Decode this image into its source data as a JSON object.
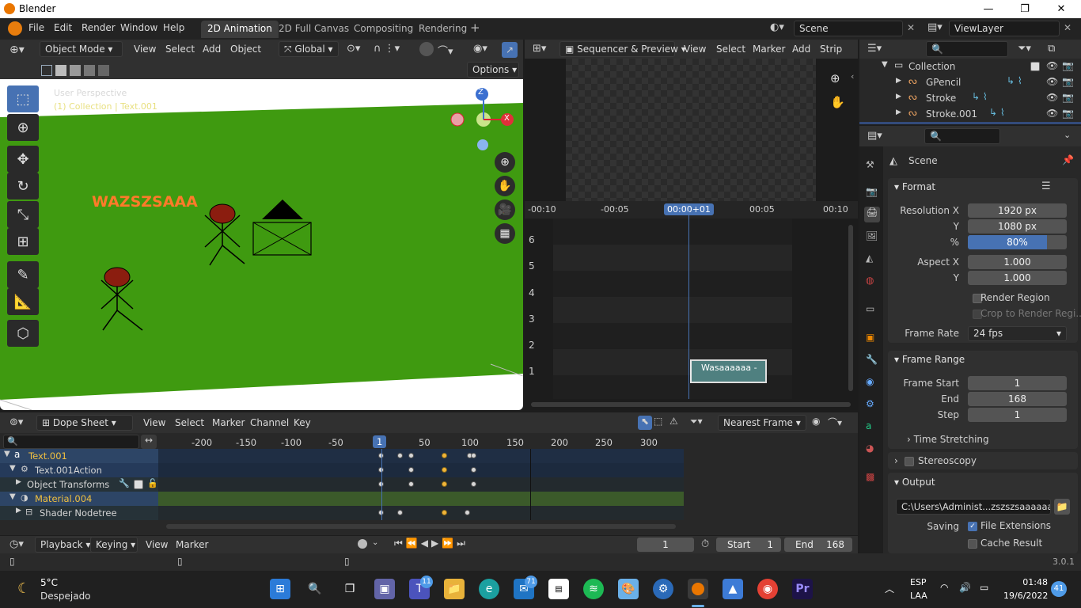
{
  "window": {
    "title": "Blender",
    "min": "—",
    "max": "❐",
    "close": "✕"
  },
  "menu": [
    "File",
    "Edit",
    "Render",
    "Window",
    "Help"
  ],
  "workspaces": [
    {
      "label": "2D Animation",
      "active": true
    },
    {
      "label": "2D Full Canvas",
      "active": false
    },
    {
      "label": "Compositing",
      "active": false
    },
    {
      "label": "Rendering",
      "active": false
    }
  ],
  "scene": {
    "name": "Scene",
    "viewlayer": "ViewLayer"
  },
  "viewport": {
    "mode": "Object Mode",
    "menus": [
      "View",
      "Select",
      "Add",
      "Object"
    ],
    "transform": "Global",
    "options": "Options",
    "overlay_line1": "User Perspective",
    "overlay_line2": "(1) Collection | Text.001",
    "text_object": "WAZSZSAAA",
    "gizmo": {
      "z": "Z",
      "x": "X"
    }
  },
  "sequencer": {
    "mode": "Sequencer & Preview",
    "menus": [
      "View",
      "Select",
      "Marker",
      "Add",
      "Strip"
    ],
    "ruler": [
      "-00:10",
      "-00:05",
      "00:00+01",
      "00:05",
      "00:10"
    ],
    "channels": [
      "6",
      "5",
      "4",
      "3",
      "2",
      "1"
    ],
    "strip": "Wasaaaaaa -"
  },
  "outliner": {
    "items": [
      {
        "name": "Collection",
        "level": 0
      },
      {
        "name": "GPencil",
        "level": 1
      },
      {
        "name": "Stroke",
        "level": 1
      },
      {
        "name": "Stroke.001",
        "level": 1
      }
    ]
  },
  "properties": {
    "context": "Scene",
    "format": {
      "title": "Format",
      "res_x_label": "Resolution X",
      "res_x": "1920 px",
      "res_y_label": "Y",
      "res_y": "1080 px",
      "pct_label": "%",
      "pct": "80%",
      "pct_value": 0.8,
      "aspect_x_label": "Aspect X",
      "aspect_x": "1.000",
      "aspect_y_label": "Y",
      "aspect_y": "1.000",
      "render_region": "Render Region",
      "crop": "Crop to Render Regi...",
      "frame_rate_label": "Frame Rate",
      "frame_rate": "24 fps"
    },
    "frame_range": {
      "title": "Frame Range",
      "start_label": "Frame Start",
      "start": "1",
      "end_label": "End",
      "end": "168",
      "step_label": "Step",
      "step": "1",
      "time_stretching": "Time Stretching"
    },
    "stereoscopy": "Stereoscopy",
    "output": {
      "title": "Output",
      "path": "C:\\Users\\Administ...zszszsaaaaaaa111",
      "saving_label": "Saving",
      "file_ext": "File Extensions",
      "cache": "Cache Result"
    }
  },
  "dopesheet": {
    "mode": "Dope Sheet",
    "menus": [
      "View",
      "Select",
      "Marker",
      "Channel",
      "Key"
    ],
    "snap": "Nearest Frame",
    "ruler": [
      "-200",
      "-150",
      "-100",
      "-50",
      "1",
      "50",
      "100",
      "150",
      "200",
      "250",
      "300"
    ],
    "current_frame": "1",
    "channels": [
      {
        "name": "Text.001",
        "keys": [
          1,
          22,
          35,
          72,
          100,
          105
        ]
      },
      {
        "name": "Text.001Action",
        "keys": [
          1,
          35,
          72,
          105
        ]
      },
      {
        "name": "Object Transforms",
        "keys": [
          1,
          35,
          72,
          105
        ]
      },
      {
        "name": "Material.004",
        "keys": []
      },
      {
        "name": "Shader Nodetree",
        "keys": [
          1,
          22,
          72,
          98
        ]
      }
    ],
    "selected_keys": [
      72
    ]
  },
  "timeline": {
    "menus": [
      "Playback",
      "Keying",
      "View",
      "Marker"
    ],
    "frame": "1",
    "start_label": "Start",
    "start": "1",
    "end_label": "End",
    "end": "168"
  },
  "status": {
    "version": "3.0.1"
  },
  "taskbar": {
    "weather_temp": "5°C",
    "weather_desc": "Despejado",
    "lang1": "ESP",
    "lang2": "LAA",
    "time": "01:48",
    "date": "19/6/2022",
    "notif": "41",
    "badge_teams": "11",
    "badge_mail": "71"
  },
  "colors": {
    "accent": "#4772b3",
    "key_selected": "#f1b53a",
    "ground": "#3f9a10"
  }
}
